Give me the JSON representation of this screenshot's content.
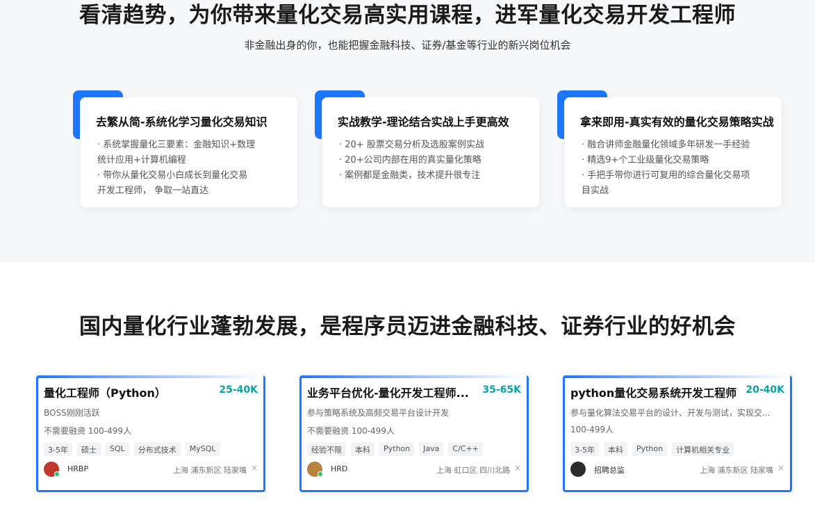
{
  "section1": {
    "title": "看清趋势，为你带来量化交易高实用课程，进军量化交易开发工程师",
    "subtitle": "非金融出身的你，也能把握金融科技、证券/基金等行业的新兴岗位机会",
    "features": [
      {
        "title": "去繁从简-系统化学习量化交易知识",
        "lines": [
          "· 系统掌握量化三要素：金融知识+数理",
          "统计应用+计算机编程",
          "· 带你从量化交易小白成长到量化交易",
          "开发工程师， 争取一站直达"
        ]
      },
      {
        "title": "实战教学-理论结合实战上手更高效",
        "lines": [
          "· 20+ 股票交易分析及选股案例实战",
          "· 20+公司内部在用的真实量化策略",
          "· 案例都是金融类，技术提升很专注"
        ]
      },
      {
        "title": "拿来即用-真实有效的量化交易策略实战",
        "lines": [
          "· 融合讲师金融量化领域多年研发一手经验",
          "· 精选9+个工业级量化交易策略",
          "· 手把手带你进行可复用的综合量化交易项",
          "目实战"
        ]
      }
    ]
  },
  "section2": {
    "title": "国内量化行业蓬勃发展，是程序员迈进金融科技、证券行业的好机会",
    "jobs": [
      {
        "title": "量化工程师（Python）",
        "salary": "25-40K",
        "status": "BOSS刚刚活跃",
        "meta": "不需要融资  100-499人",
        "tags": [
          "3-5年",
          "硕士",
          "SQL",
          "分布式技术",
          "MySQL"
        ],
        "recruiter": "HRBP",
        "location": "上海  浦东新区  陆家嘴",
        "avatar_color": "#c0392b"
      },
      {
        "title": "业务平台优化-量化开发工程师...",
        "salary": "35-65K",
        "status": "参与策略系统及高频交易平台设计开发",
        "meta": "不需要融资  100-499人",
        "tags": [
          "经验不限",
          "本科",
          "Python",
          "Java",
          "C/C++"
        ],
        "recruiter": "HRD",
        "location": "上海  虹口区  四川北路",
        "avatar_color": "#b9833f"
      },
      {
        "title": "python量化交易系统开发工程师",
        "salary": "20-40K",
        "status": "参与量化算法交易平台的设计、开发与测试，实现交...",
        "meta": "100-499人",
        "tags": [
          "3-5年",
          "本科",
          "Python",
          "计算机相关专业"
        ],
        "recruiter": "招聘总监",
        "location": "上海  浦东新区  陆家嘴",
        "avatar_color": "#2b2b2b"
      }
    ],
    "close_glyph": "×"
  }
}
